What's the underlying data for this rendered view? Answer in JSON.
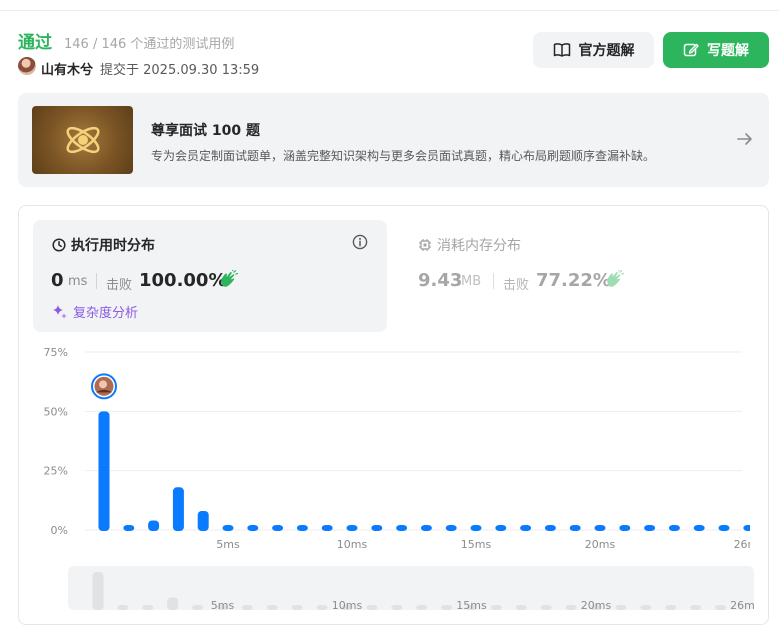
{
  "header": {
    "status": "通过",
    "pass_count": "146 / 146 个通过的测试用例",
    "username": "山有木兮",
    "submit_time": "提交于 2025.09.30 13:59",
    "official_solution_label": "官方题解",
    "write_solution_label": "写题解"
  },
  "promo": {
    "title": "尊享面试 100 题",
    "description": "专为会员定制面试题单，涵盖完整知识架构与更多会员面试真题，精心布局刷题顺序查漏补缺。"
  },
  "runtime": {
    "title": "执行用时分布",
    "value": "0",
    "unit": "ms",
    "beats_label": "击败",
    "beats": "100.00%",
    "complexity_label": "复杂度分析"
  },
  "memory": {
    "title": "消耗内存分布",
    "value": "9.43",
    "unit": "MB",
    "beats_label": "击败",
    "beats": "77.22%"
  },
  "colors": {
    "accept_green": "#2db55d",
    "bar_blue": "#0a7aff",
    "complexity_purple": "#8a5be6"
  },
  "chart_data": {
    "type": "bar",
    "x": [
      0,
      1,
      2,
      3,
      4,
      5,
      6,
      7,
      8,
      9,
      10,
      11,
      12,
      13,
      14,
      15,
      16,
      17,
      18,
      19,
      20,
      21,
      22,
      23,
      24,
      25,
      26
    ],
    "values": [
      50,
      1.5,
      4,
      18,
      8,
      1.5,
      1.5,
      1.5,
      1.5,
      1.5,
      1.5,
      1.5,
      1.5,
      1.5,
      1.5,
      1.5,
      1.5,
      1.5,
      1.5,
      1.5,
      1.5,
      1.5,
      1.5,
      1.5,
      1.5,
      1.5,
      1.5
    ],
    "xticks": [
      {
        "value": 5,
        "label": "5ms"
      },
      {
        "value": 10,
        "label": "10ms"
      },
      {
        "value": 15,
        "label": "15ms"
      },
      {
        "value": 20,
        "label": "20ms"
      },
      {
        "value": 26,
        "label": "26ms"
      }
    ],
    "yticks": [
      {
        "value": 0,
        "label": "0%"
      },
      {
        "value": 25,
        "label": "25%"
      },
      {
        "value": 50,
        "label": "50%"
      },
      {
        "value": 75,
        "label": "75%"
      }
    ],
    "ylim": [
      0,
      75
    ],
    "grid": true,
    "highlight_index": 0,
    "overview_values": [
      30,
      2,
      2,
      10,
      2,
      2,
      2,
      2,
      2,
      2,
      2,
      2,
      2,
      2,
      2,
      2,
      2,
      2,
      2,
      2,
      2,
      2,
      2,
      2,
      2,
      2
    ]
  }
}
